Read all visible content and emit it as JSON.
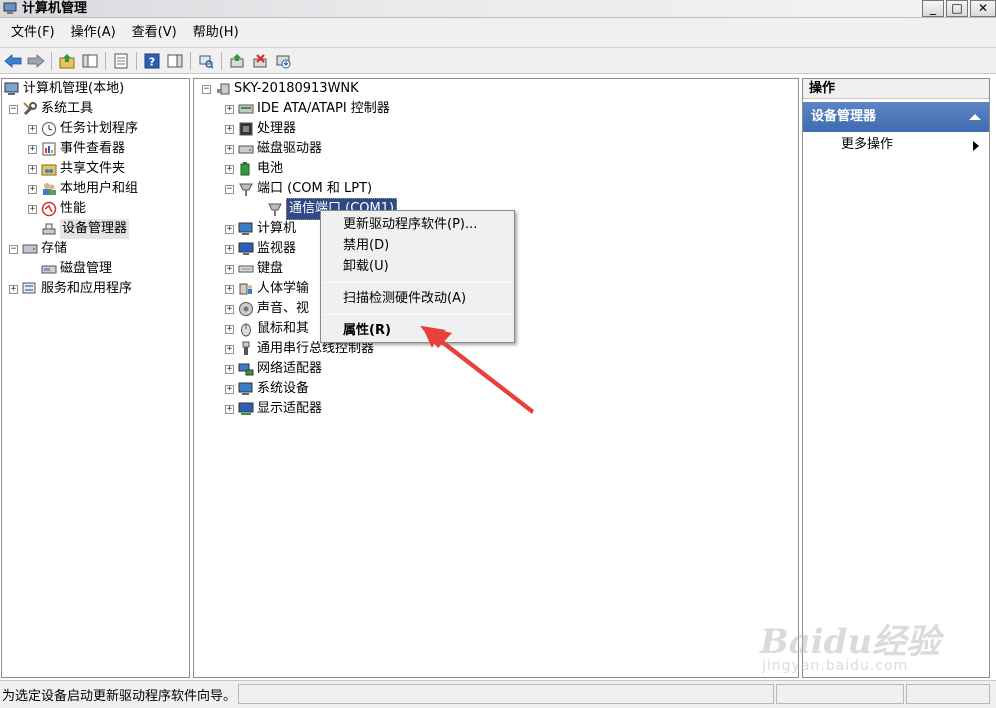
{
  "window": {
    "title": "计算机管理",
    "min_glyph": "_",
    "max_glyph": "□",
    "close_glyph": "✕"
  },
  "menubar": [
    {
      "label": "文件(F)"
    },
    {
      "label": "操作(A)"
    },
    {
      "label": "查看(V)"
    },
    {
      "label": "帮助(H)"
    }
  ],
  "toolbar_icons": [
    "back-icon",
    "forward-icon",
    "up-folder-icon",
    "show-hide-tree-icon",
    "export-list-icon",
    "help-icon",
    "show-hide-action-pane-icon",
    "scan-hardware-icon",
    "update-driver-icon",
    "uninstall-icon",
    "disable-device-icon"
  ],
  "left_tree": {
    "root": "计算机管理(本地)",
    "system_tools": "系统工具",
    "task_scheduler": "任务计划程序",
    "event_viewer": "事件查看器",
    "shared_folders": "共享文件夹",
    "local_users": "本地用户和组",
    "performance": "性能",
    "device_manager": "设备管理器",
    "storage": "存储",
    "disk_management": "磁盘管理",
    "services_apps": "服务和应用程序"
  },
  "device_tree": {
    "computer": "SKY-20180913WNK",
    "categories": [
      {
        "label": "IDE ATA/ATAPI 控制器",
        "icon": "ide-controller-icon",
        "expanded": false
      },
      {
        "label": "处理器",
        "icon": "processor-icon",
        "expanded": false
      },
      {
        "label": "磁盘驱动器",
        "icon": "disk-drive-icon",
        "expanded": false
      },
      {
        "label": "电池",
        "icon": "battery-icon",
        "expanded": false
      },
      {
        "label": "端口 (COM 和 LPT)",
        "icon": "port-icon",
        "expanded": true
      },
      {
        "label": "计算机",
        "icon": "computer-icon",
        "expanded": false
      },
      {
        "label": "监视器",
        "icon": "monitor-icon",
        "expanded": false
      },
      {
        "label": "键盘",
        "icon": "keyboard-icon",
        "expanded": false
      },
      {
        "label": "人体学输",
        "icon": "hid-icon",
        "expanded": false
      },
      {
        "label": "声音、视",
        "icon": "sound-icon",
        "expanded": false
      },
      {
        "label": "鼠标和其",
        "icon": "mouse-icon",
        "expanded": false
      },
      {
        "label": "通用串行总线控制器",
        "icon": "usb-icon",
        "expanded": false
      },
      {
        "label": "网络适配器",
        "icon": "network-adapter-icon",
        "expanded": false
      },
      {
        "label": "系统设备",
        "icon": "system-device-icon",
        "expanded": false
      },
      {
        "label": "显示适配器",
        "icon": "display-adapter-icon",
        "expanded": false
      }
    ],
    "selected_child": "通信端口 (COM1)"
  },
  "context_menu": {
    "update_driver": "更新驱动程序软件(P)...",
    "disable": "禁用(D)",
    "uninstall": "卸载(U)",
    "scan": "扫描检测硬件改动(A)",
    "properties": "属性(R)"
  },
  "actions_pane": {
    "header": "操作",
    "section": "设备管理器",
    "more": "更多操作"
  },
  "status_bar": {
    "text": "为选定设备启动更新驱动程序软件向导。"
  },
  "watermark": {
    "brand": "Baidu经验",
    "url": "jingyan.baidu.com"
  },
  "colors": {
    "selection_blue": "#2f4a87",
    "actions_blue": "#4a76b8",
    "arrow_red": "#e8403a"
  }
}
